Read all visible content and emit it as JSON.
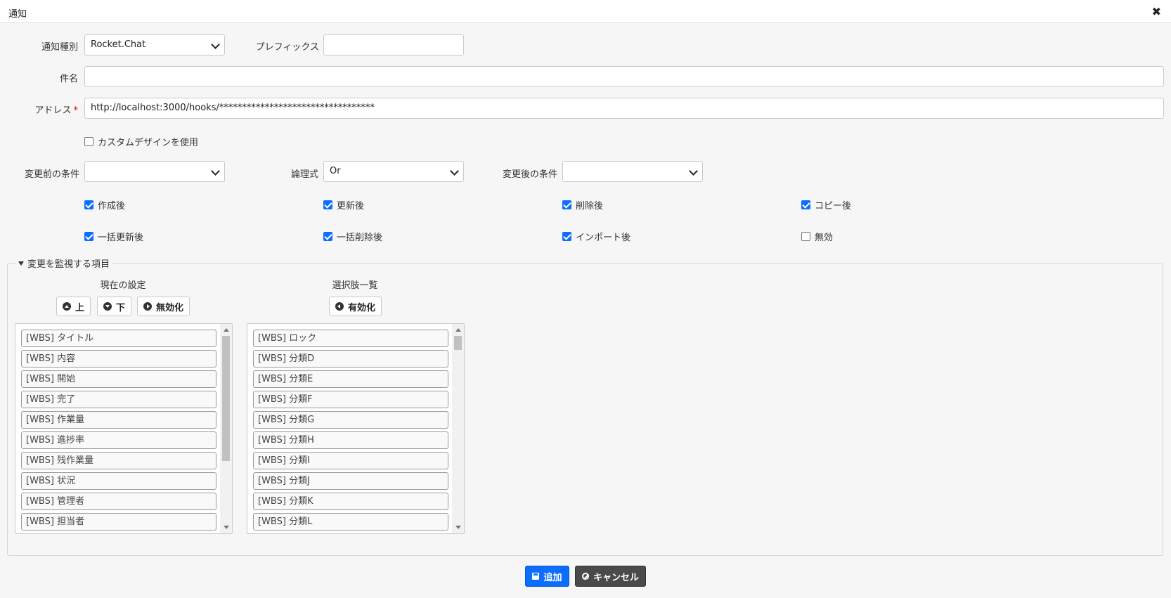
{
  "dialog": {
    "title": "通知",
    "close_icon": "close-icon"
  },
  "form": {
    "notify_type": {
      "label": "通知種別",
      "value": "Rocket.Chat"
    },
    "prefix": {
      "label": "プレフィックス",
      "value": ""
    },
    "subject": {
      "label": "件名",
      "value": ""
    },
    "address": {
      "label": "アドレス",
      "required_mark": "*",
      "value": "http://localhost:3000/hooks/**********************************"
    },
    "custom_design": {
      "label": "カスタムデザインを使用",
      "checked": false
    },
    "before_condition": {
      "label": "変更前の条件",
      "value": ""
    },
    "logic": {
      "label": "論理式",
      "value": "Or"
    },
    "after_condition": {
      "label": "変更後の条件",
      "value": ""
    }
  },
  "triggers": [
    {
      "label": "作成後",
      "checked": true
    },
    {
      "label": "更新後",
      "checked": true
    },
    {
      "label": "削除後",
      "checked": true
    },
    {
      "label": "コピー後",
      "checked": true
    },
    {
      "label": "一括更新後",
      "checked": true
    },
    {
      "label": "一括削除後",
      "checked": true
    },
    {
      "label": "インポート後",
      "checked": true
    },
    {
      "label": "無効",
      "checked": false
    }
  ],
  "monitor": {
    "legend": "変更を監視する項目",
    "current": {
      "heading": "現在の設定",
      "btn_up": "上",
      "btn_down": "下",
      "btn_disable": "無効化",
      "items": [
        "[WBS] タイトル",
        "[WBS] 内容",
        "[WBS] 開始",
        "[WBS] 完了",
        "[WBS] 作業量",
        "[WBS] 進捗率",
        "[WBS] 残作業量",
        "[WBS] 状況",
        "[WBS] 管理者",
        "[WBS] 担当者"
      ]
    },
    "options": {
      "heading": "選択肢一覧",
      "btn_enable": "有効化",
      "items": [
        "[WBS] ロック",
        "[WBS] 分類D",
        "[WBS] 分類E",
        "[WBS] 分類F",
        "[WBS] 分類G",
        "[WBS] 分類H",
        "[WBS] 分類I",
        "[WBS] 分類J",
        "[WBS] 分類K",
        "[WBS] 分類L"
      ]
    }
  },
  "footer": {
    "add": "追加",
    "cancel": "キャンセル"
  }
}
